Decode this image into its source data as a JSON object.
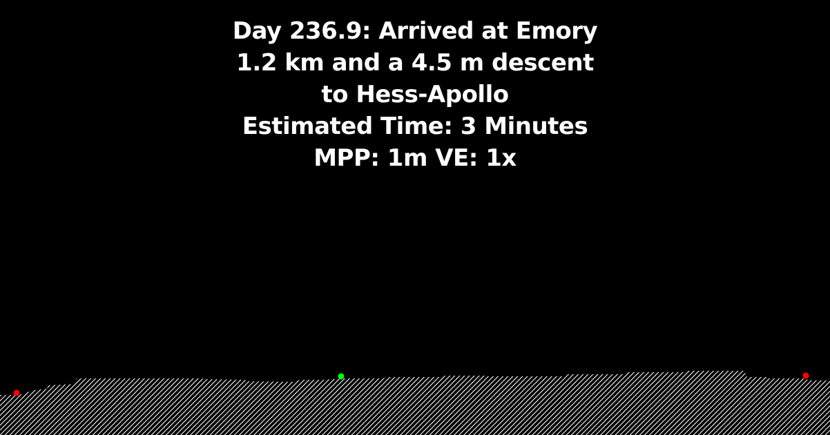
{
  "caption": {
    "line1": "Day 236.9: Arrived at Emory",
    "line2": "1.2 km and a 4.5 m descent",
    "line3": "to Hess-Apollo",
    "line4": "Estimated Time: 3 Minutes",
    "line5": "MPP: 1m VE: 1x"
  },
  "colors": {
    "background": "#000000",
    "text": "#ffffff",
    "terrain_hatch": "#ffffff",
    "current_marker": "#00ff00",
    "endpoint_marker": "#ff0000"
  }
}
